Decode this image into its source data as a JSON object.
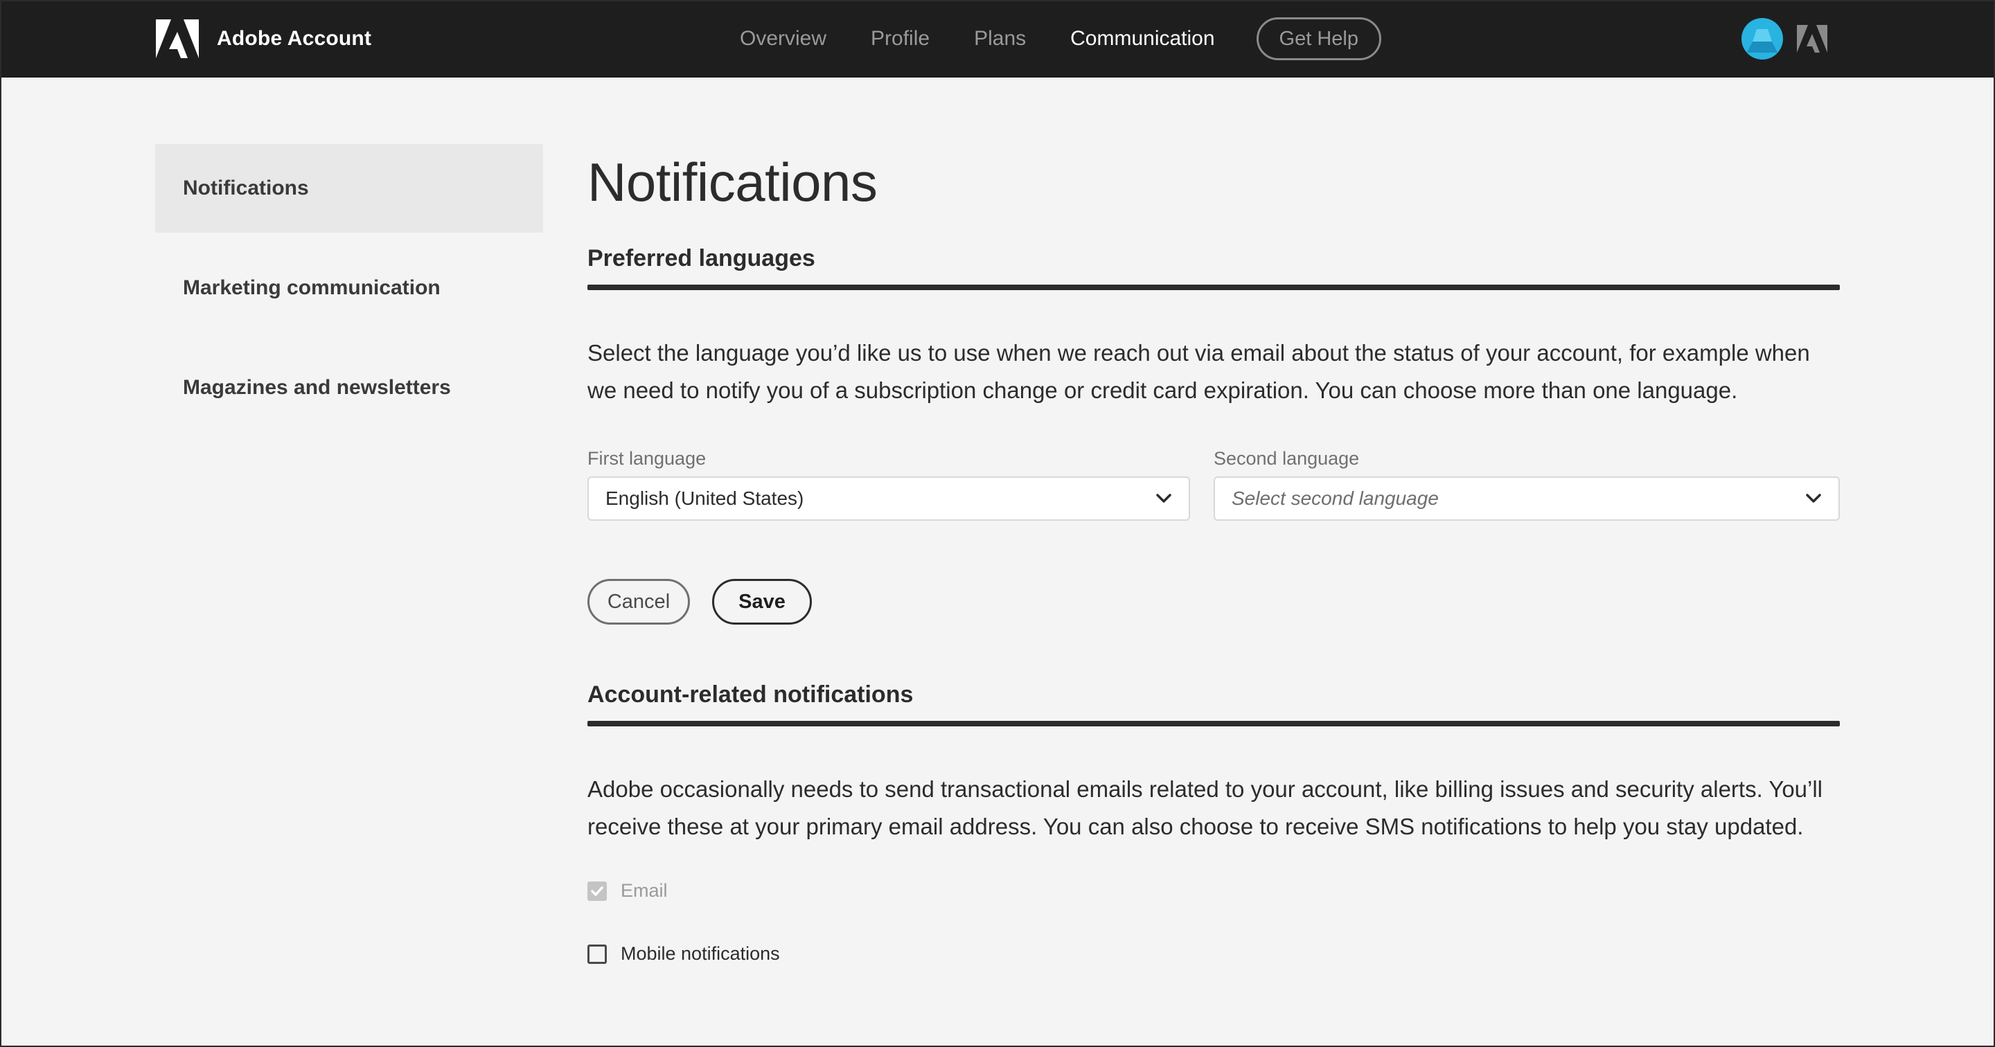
{
  "header": {
    "brand": "Adobe Account",
    "nav": [
      {
        "label": "Overview",
        "active": false
      },
      {
        "label": "Profile",
        "active": false
      },
      {
        "label": "Plans",
        "active": false
      },
      {
        "label": "Communication",
        "active": true
      }
    ],
    "help_label": "Get Help",
    "avatar_color": "#29b3e0"
  },
  "sidebar": {
    "items": [
      {
        "label": "Notifications",
        "active": true
      },
      {
        "label": "Marketing communication",
        "active": false
      },
      {
        "label": "Magazines and newsletters",
        "active": false
      }
    ]
  },
  "main": {
    "title": "Notifications",
    "languages": {
      "heading": "Preferred languages",
      "description": "Select the language you’d like us to use when we reach out via email about the status of your account, for example when we need to notify you of a subscription change or credit card expiration. You can choose more than one language.",
      "first_label": "First language",
      "first_value": "English (United States)",
      "second_label": "Second language",
      "second_placeholder": "Select second language",
      "cancel_label": "Cancel",
      "save_label": "Save"
    },
    "account": {
      "heading": "Account-related notifications",
      "description": "Adobe occasionally needs to send transactional emails related to your account, like billing issues and security alerts. You’ll receive these at your primary email address. You can also choose to receive SMS notifications to help you stay updated.",
      "email_label": "Email",
      "email_checked": true,
      "email_disabled": true,
      "mobile_label": "Mobile notifications",
      "mobile_checked": false
    }
  }
}
